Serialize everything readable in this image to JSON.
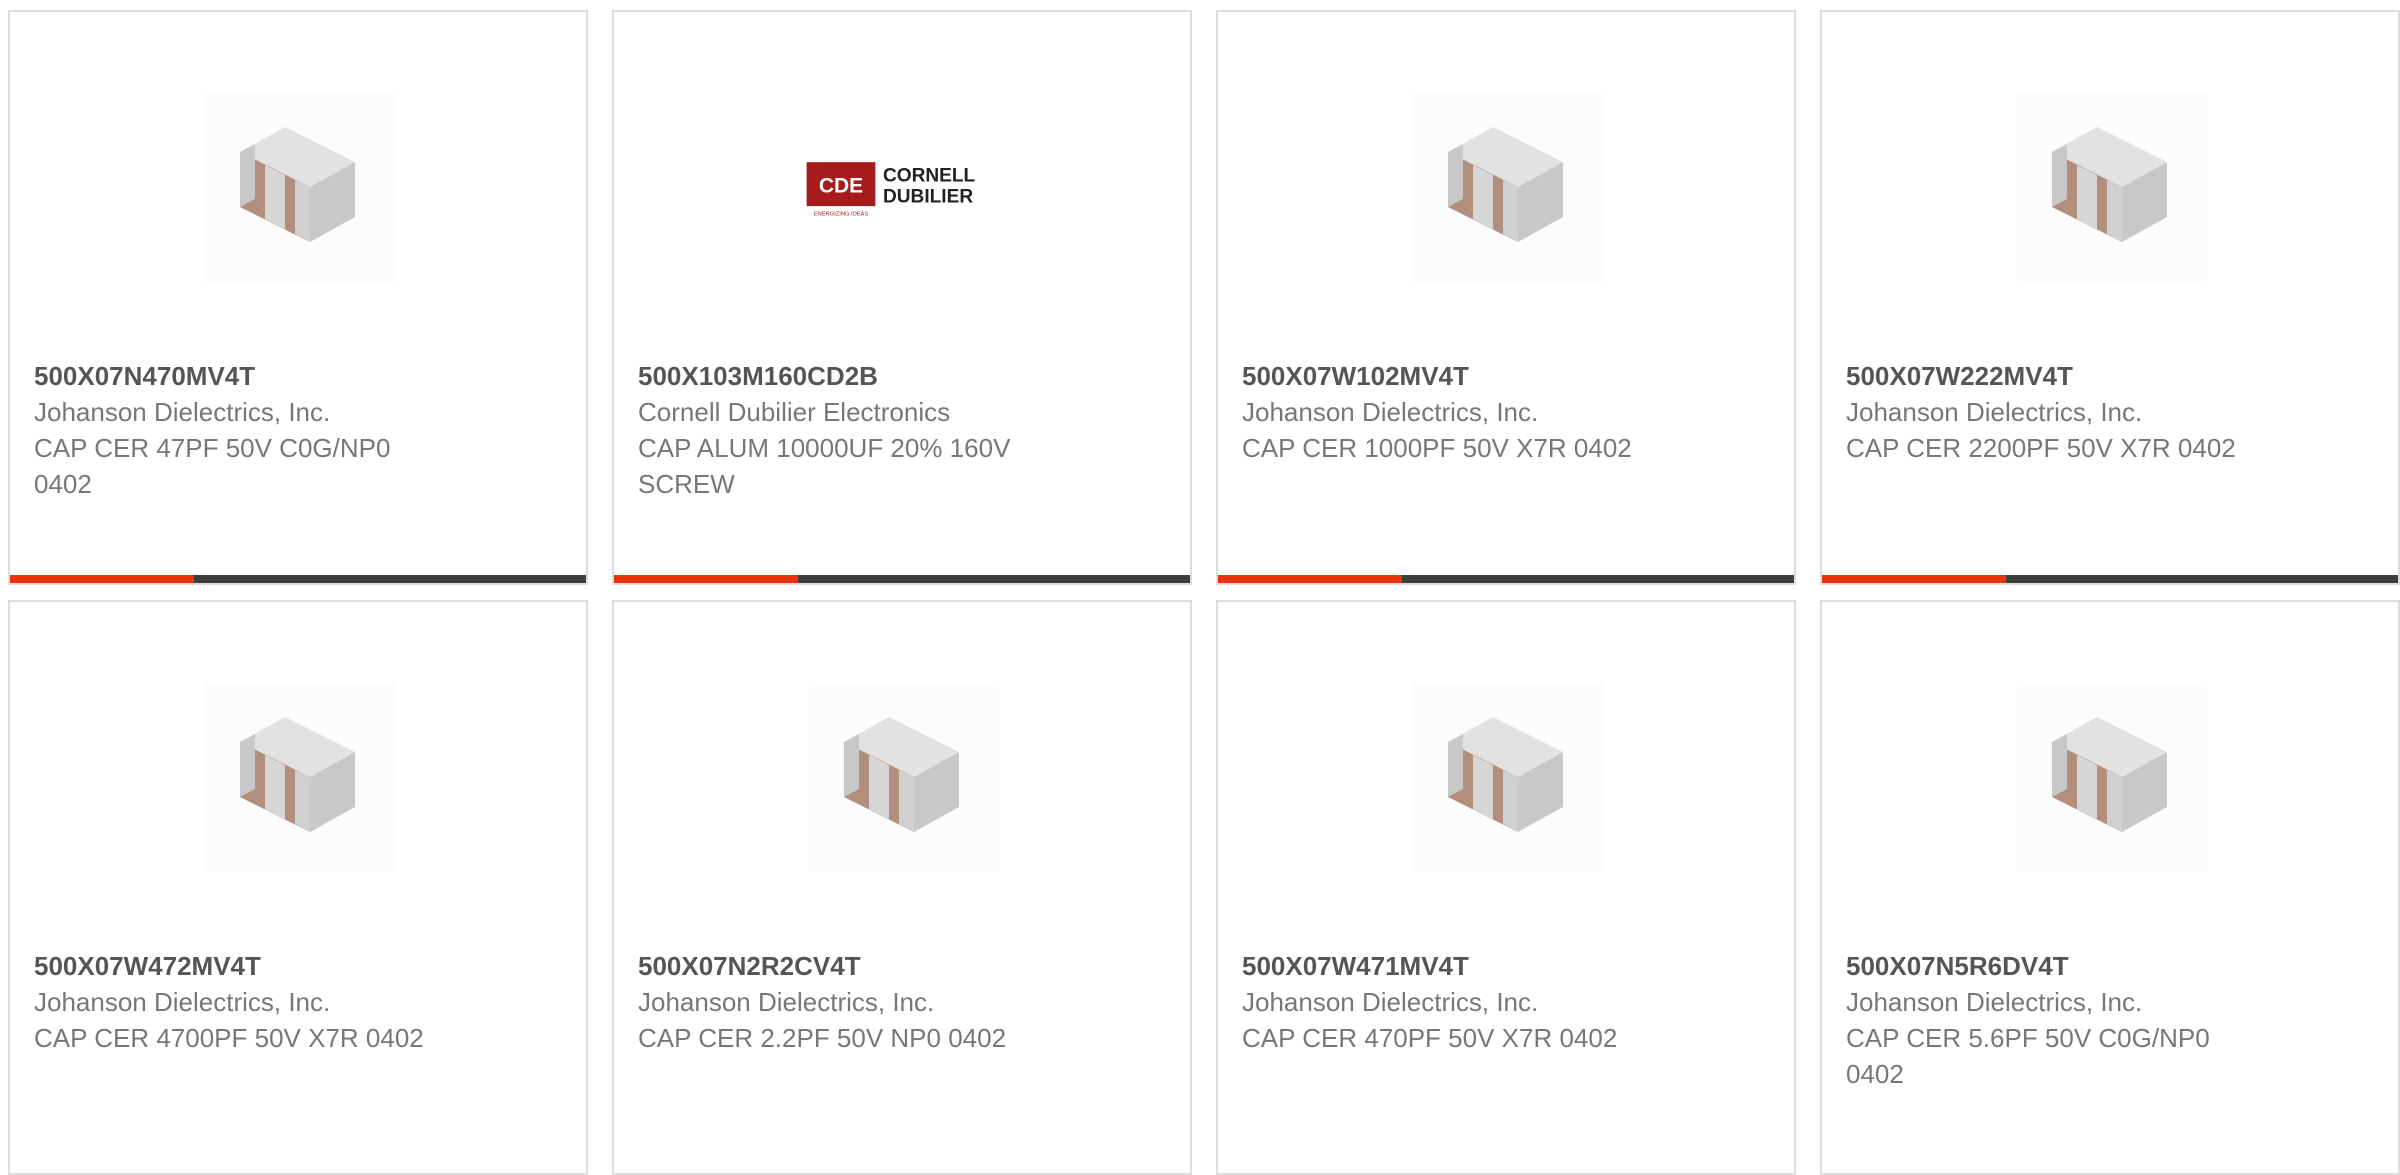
{
  "colors": {
    "accent": "#e8350e",
    "bar_track": "#3e3e3e",
    "card_border": "#dcdcdc",
    "part_text": "#555555",
    "body_text": "#777777",
    "cap_body": "#b28e7c",
    "cap_terminal": "#d6d6d6",
    "cde_logo_red": "#a61b1b"
  },
  "products": [
    {
      "part_number": "500X07N470MV4T",
      "manufacturer": "Johanson Dielectrics, Inc.",
      "description": "CAP CER 47PF 50V C0G/NP0 0402",
      "image": "ceramic-capacitor-icon",
      "progress": 0.32
    },
    {
      "part_number": "500X103M160CD2B",
      "manufacturer": "Cornell Dubilier Electronics",
      "description": "CAP ALUM 10000UF 20% 160V SCREW",
      "image": "cornell-dubilier-logo",
      "logo": {
        "badge": "CDE",
        "line1": "CORNELL",
        "line2": "DUBILIER",
        "tagline": "ENERGIZING IDEAS"
      },
      "progress": 0.32
    },
    {
      "part_number": "500X07W102MV4T",
      "manufacturer": "Johanson Dielectrics, Inc.",
      "description": "CAP CER 1000PF 50V X7R 0402",
      "image": "ceramic-capacitor-icon",
      "progress": 0.32
    },
    {
      "part_number": "500X07W222MV4T",
      "manufacturer": "Johanson Dielectrics, Inc.",
      "description": "CAP CER 2200PF 50V X7R 0402",
      "image": "ceramic-capacitor-icon",
      "progress": 0.32
    },
    {
      "part_number": "500X07W472MV4T",
      "manufacturer": "Johanson Dielectrics, Inc.",
      "description": "CAP CER 4700PF 50V X7R 0402",
      "image": "ceramic-capacitor-icon"
    },
    {
      "part_number": "500X07N2R2CV4T",
      "manufacturer": "Johanson Dielectrics, Inc.",
      "description": "CAP CER 2.2PF 50V NP0 0402",
      "image": "ceramic-capacitor-icon"
    },
    {
      "part_number": "500X07W471MV4T",
      "manufacturer": "Johanson Dielectrics, Inc.",
      "description": "CAP CER 470PF 50V X7R 0402",
      "image": "ceramic-capacitor-icon"
    },
    {
      "part_number": "500X07N5R6DV4T",
      "manufacturer": "Johanson Dielectrics, Inc.",
      "description": "CAP CER 5.6PF 50V C0G/NP0 0402",
      "image": "ceramic-capacitor-icon"
    }
  ]
}
